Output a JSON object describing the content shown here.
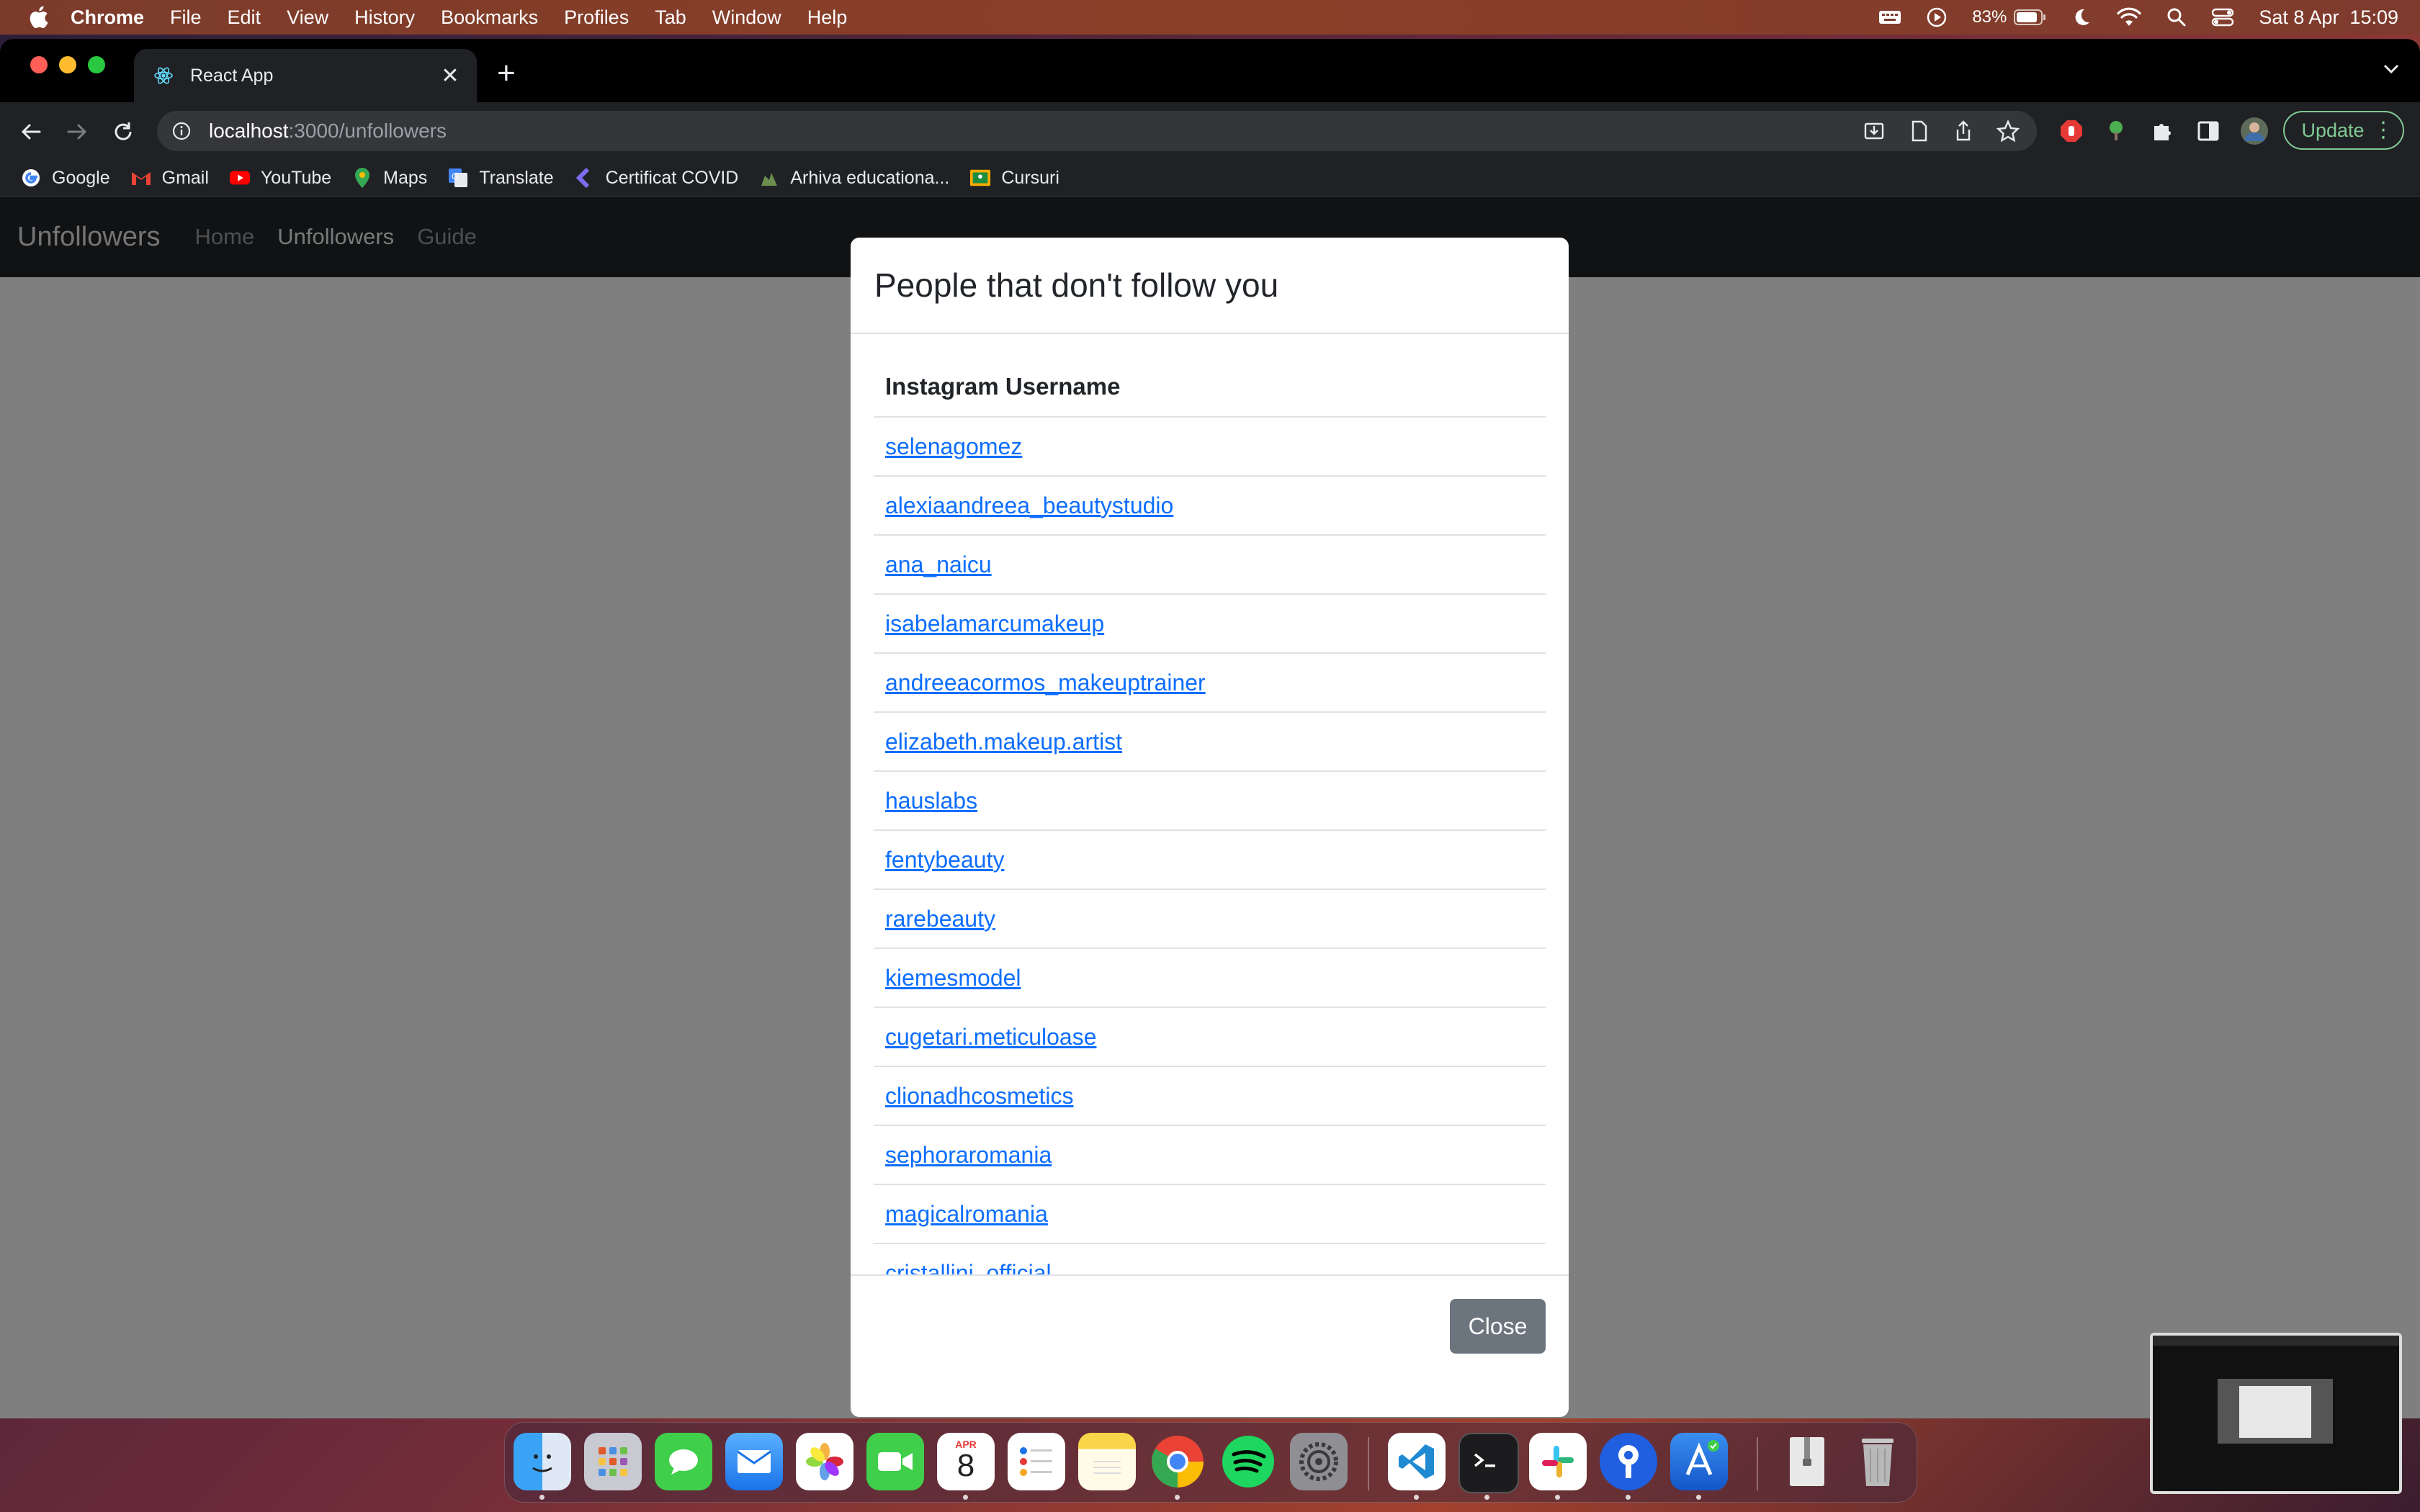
{
  "menubar": {
    "app": "Chrome",
    "items": [
      "File",
      "Edit",
      "View",
      "History",
      "Bookmarks",
      "Profiles",
      "Tab",
      "Window",
      "Help"
    ],
    "battery": "83%",
    "datetime": "Sat 8 Apr  15:09"
  },
  "browser": {
    "tab_title": "React App",
    "url_host": "localhost",
    "url_path": ":3000/unfollowers",
    "update_label": "Update",
    "bookmarks": [
      "Google",
      "Gmail",
      "YouTube",
      "Maps",
      "Translate",
      "Certificat COVID",
      "Arhiva educationa...",
      "Cursuri"
    ]
  },
  "app": {
    "brand": "Unfollowers",
    "nav": [
      "Home",
      "Unfollowers",
      "Guide"
    ],
    "active_nav": "Unfollowers"
  },
  "modal": {
    "title": "People that don't follow you",
    "column_header": "Instagram Username",
    "usernames": [
      "selenagomez",
      "alexiaandreea_beautystudio",
      "ana_naicu",
      "isabelamarcumakeup",
      "andreeacormos_makeuptrainer",
      "elizabeth.makeup.artist",
      "hauslabs",
      "fentybeauty",
      "rarebeauty",
      "kiemesmodel",
      "cugetari.meticuloase",
      "clionadhcosmetics",
      "sephoraromania",
      "magicalromania",
      "cristallini_official"
    ],
    "close_label": "Close"
  },
  "dock": {
    "apps": [
      "finder-icon",
      "launchpad-icon",
      "messages-icon",
      "mail-icon",
      "photos-icon",
      "facetime-icon",
      "calendar-icon",
      "reminders-icon",
      "notes-icon",
      "chrome-icon",
      "spotify-icon",
      "system-settings-icon",
      "vscode-icon",
      "terminal-icon",
      "slack-icon",
      "sourcetree-icon",
      "xcode-icon",
      "downloads-icon",
      "trash-icon"
    ],
    "calendar_month": "APR",
    "calendar_day": "8"
  }
}
